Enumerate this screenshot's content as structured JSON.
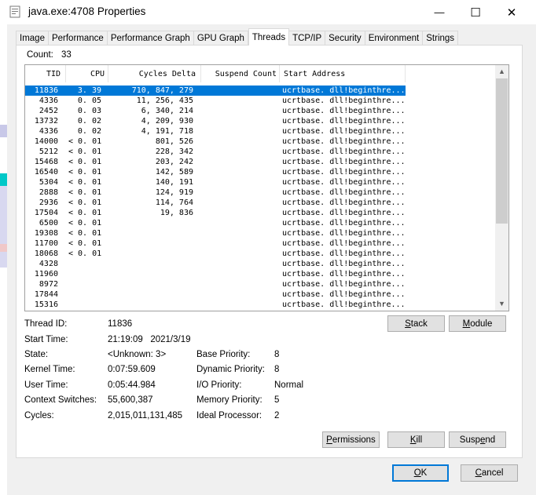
{
  "window": {
    "title": "java.exe:4708 Properties",
    "controls": {
      "minimize": "—",
      "maximize": "☐",
      "close": "✕"
    }
  },
  "tabs": [
    {
      "label": "Image"
    },
    {
      "label": "Performance"
    },
    {
      "label": "Performance Graph"
    },
    {
      "label": "GPU Graph"
    },
    {
      "label": "Threads",
      "active": true
    },
    {
      "label": "TCP/IP"
    },
    {
      "label": "Security"
    },
    {
      "label": "Environment"
    },
    {
      "label": "Strings"
    }
  ],
  "threads": {
    "count_label": "Count:",
    "count_value": "33",
    "columns": [
      "TID",
      "CPU",
      "Cycles Delta",
      "Suspend Count",
      "Start Address"
    ],
    "sort_arrow": "﹀",
    "rows": [
      {
        "tid": "11836",
        "cpu": "3. 39",
        "cycles": "710, 847, 279",
        "addr": "ucrtbase. dll!beginthre...",
        "selected": true
      },
      {
        "tid": "4336",
        "cpu": "0. 05",
        "cycles": "11, 256, 435",
        "addr": "ucrtbase. dll!beginthre..."
      },
      {
        "tid": "2452",
        "cpu": "0. 03",
        "cycles": "6, 340, 214",
        "addr": "ucrtbase. dll!beginthre..."
      },
      {
        "tid": "13732",
        "cpu": "0. 02",
        "cycles": "4, 209, 930",
        "addr": "ucrtbase. dll!beginthre..."
      },
      {
        "tid": "4336",
        "cpu": "0. 02",
        "cycles": "4, 191, 718",
        "addr": "ucrtbase. dll!beginthre..."
      },
      {
        "tid": "14000",
        "cpu": "< 0. 01",
        "cycles": "801, 526",
        "addr": "ucrtbase. dll!beginthre..."
      },
      {
        "tid": "5212",
        "cpu": "< 0. 01",
        "cycles": "228, 342",
        "addr": "ucrtbase. dll!beginthre..."
      },
      {
        "tid": "15468",
        "cpu": "< 0. 01",
        "cycles": "203, 242",
        "addr": "ucrtbase. dll!beginthre..."
      },
      {
        "tid": "16540",
        "cpu": "< 0. 01",
        "cycles": "142, 589",
        "addr": "ucrtbase. dll!beginthre..."
      },
      {
        "tid": "5304",
        "cpu": "< 0. 01",
        "cycles": "140, 191",
        "addr": "ucrtbase. dll!beginthre..."
      },
      {
        "tid": "2888",
        "cpu": "< 0. 01",
        "cycles": "124, 919",
        "addr": "ucrtbase. dll!beginthre..."
      },
      {
        "tid": "2936",
        "cpu": "< 0. 01",
        "cycles": "114, 764",
        "addr": "ucrtbase. dll!beginthre..."
      },
      {
        "tid": "17504",
        "cpu": "< 0. 01",
        "cycles": "19, 836",
        "addr": "ucrtbase. dll!beginthre..."
      },
      {
        "tid": "6500",
        "cpu": "< 0. 01",
        "cycles": "",
        "addr": "ucrtbase. dll!beginthre..."
      },
      {
        "tid": "19308",
        "cpu": "< 0. 01",
        "cycles": "",
        "addr": "ucrtbase. dll!beginthre..."
      },
      {
        "tid": "11700",
        "cpu": "< 0. 01",
        "cycles": "",
        "addr": "ucrtbase. dll!beginthre..."
      },
      {
        "tid": "18068",
        "cpu": "< 0. 01",
        "cycles": "",
        "addr": "ucrtbase. dll!beginthre..."
      },
      {
        "tid": "4328",
        "cpu": "",
        "cycles": "",
        "addr": "ucrtbase. dll!beginthre..."
      },
      {
        "tid": "11960",
        "cpu": "",
        "cycles": "",
        "addr": "ucrtbase. dll!beginthre..."
      },
      {
        "tid": "8972",
        "cpu": "",
        "cycles": "",
        "addr": "ucrtbase. dll!beginthre..."
      },
      {
        "tid": "17844",
        "cpu": "",
        "cycles": "",
        "addr": "ucrtbase. dll!beginthre..."
      },
      {
        "tid": "15316",
        "cpu": "",
        "cycles": "",
        "addr": "ucrtbase. dll!beginthre..."
      }
    ]
  },
  "details": {
    "thread_id_label": "Thread ID:",
    "thread_id": "11836",
    "start_time_label": "Start Time:",
    "start_time": "21:19:09   2021/3/19",
    "state_label": "State:",
    "state": "<Unknown: 3>",
    "kernel_time_label": "Kernel Time:",
    "kernel_time": "0:07:59.609",
    "user_time_label": "User Time:",
    "user_time": "0:05:44.984",
    "context_switches_label": "Context Switches:",
    "context_switches": "55,600,387",
    "cycles_label": "Cycles:",
    "cycles": "2,015,011,131,485",
    "base_priority_label": "Base Priority:",
    "base_priority": "8",
    "dynamic_priority_label": "Dynamic Priority:",
    "dynamic_priority": "8",
    "io_priority_label": "I/O Priority:",
    "io_priority": "Normal",
    "memory_priority_label": "Memory Priority:",
    "memory_priority": "5",
    "ideal_processor_label": "Ideal Processor:",
    "ideal_processor": "2"
  },
  "buttons": {
    "stack": {
      "key": "S",
      "rest": "tack"
    },
    "module": {
      "key": "M",
      "rest": "odule"
    },
    "permissions": {
      "key": "P",
      "rest": "ermissions"
    },
    "kill": {
      "key": "K",
      "rest": "ill"
    },
    "suspend": {
      "pre": "Susp",
      "key": "e",
      "rest": "nd"
    },
    "ok": {
      "key": "O",
      "rest": "K"
    },
    "cancel": {
      "key": "C",
      "rest": "ancel"
    }
  },
  "colors": {
    "selection": "#0078d7",
    "window_bg": "#f0f0f0",
    "panel_bg": "#ffffff"
  }
}
